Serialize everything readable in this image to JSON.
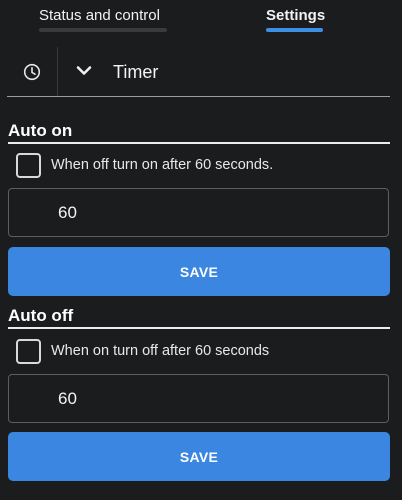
{
  "tabs": [
    {
      "label": "Status and control",
      "active": false
    },
    {
      "label": "Settings",
      "active": true
    }
  ],
  "timer": {
    "title": "Timer",
    "clock_icon": "clock-icon",
    "expand_icon": "chevron-down-icon"
  },
  "auto_on": {
    "heading": "Auto on",
    "checkbox_label": "When off turn on after 60 seconds.",
    "checked": false,
    "value": "60",
    "save_label": "SAVE"
  },
  "auto_off": {
    "heading": "Auto off",
    "checkbox_label": "When on turn off after 60 seconds",
    "checked": false,
    "value": "60",
    "save_label": "SAVE"
  },
  "colors": {
    "background": "#1b1c1e",
    "accent": "#3a86e0",
    "text": "#ffffff"
  }
}
